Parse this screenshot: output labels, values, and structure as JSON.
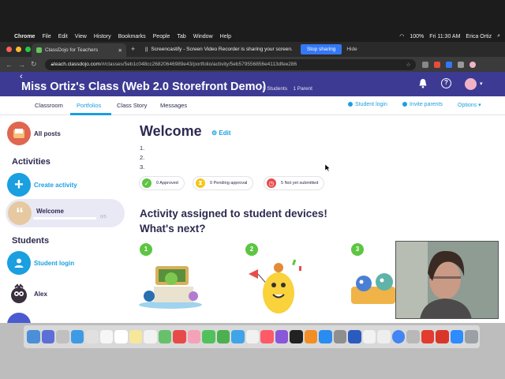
{
  "mac_menu": {
    "app": "Chrome",
    "items": [
      "File",
      "Edit",
      "View",
      "History",
      "Bookmarks",
      "People",
      "Tab",
      "Window",
      "Help"
    ],
    "battery": "100%",
    "clock": "Fri 11:30 AM",
    "user": "Erica Ortiz"
  },
  "browser": {
    "tab_title": "ClassDojo for Teachers",
    "new_tab": "+",
    "share_message": "Screencastify - Screen Video Recorder is sharing your screen.",
    "stop_sharing": "Stop sharing",
    "hide": "Hide",
    "url_host": "teach.classdojo.com",
    "url_path": "/#/classes/5eb1c048cc26820646989e43/portfolio/activity/5eb579556856e4113dfee286"
  },
  "header": {
    "title": "Miss Ortiz's Class (Web 2.0 Storefront Demo)",
    "students": "5 Students",
    "parents": "1 Parent"
  },
  "tabs": [
    "Classroom",
    "Portfolios",
    "Class Story",
    "Messages"
  ],
  "subnav_actions": {
    "student_login": "Student login",
    "invite_parents": "Invite parents",
    "options": "Options"
  },
  "sidebar": {
    "all_posts": "All posts",
    "activities_heading": "Activities",
    "create_activity": "Create activity",
    "welcome": "Welcome",
    "welcome_count": "0/5",
    "students_heading": "Students",
    "student_login": "Student login",
    "student_alex": "Alex"
  },
  "main": {
    "title": "Welcome",
    "edit": "Edit",
    "list": [
      "1.",
      "2.",
      "3."
    ],
    "status": {
      "approved": "0 Approved",
      "pending": "0 Pending approval",
      "not_submitted": "5 Not yet submitted"
    },
    "assigned_line1": "Activity assigned to student devices!",
    "assigned_line2": "What's next?",
    "steps": [
      "1",
      "2",
      "3"
    ]
  },
  "colors": {
    "header_bg": "#3d3a93",
    "accent_blue": "#1a9fe0",
    "green": "#5cc543",
    "yellow": "#f5c518",
    "red": "#e74c4c",
    "text_dark": "#2c2a50"
  }
}
